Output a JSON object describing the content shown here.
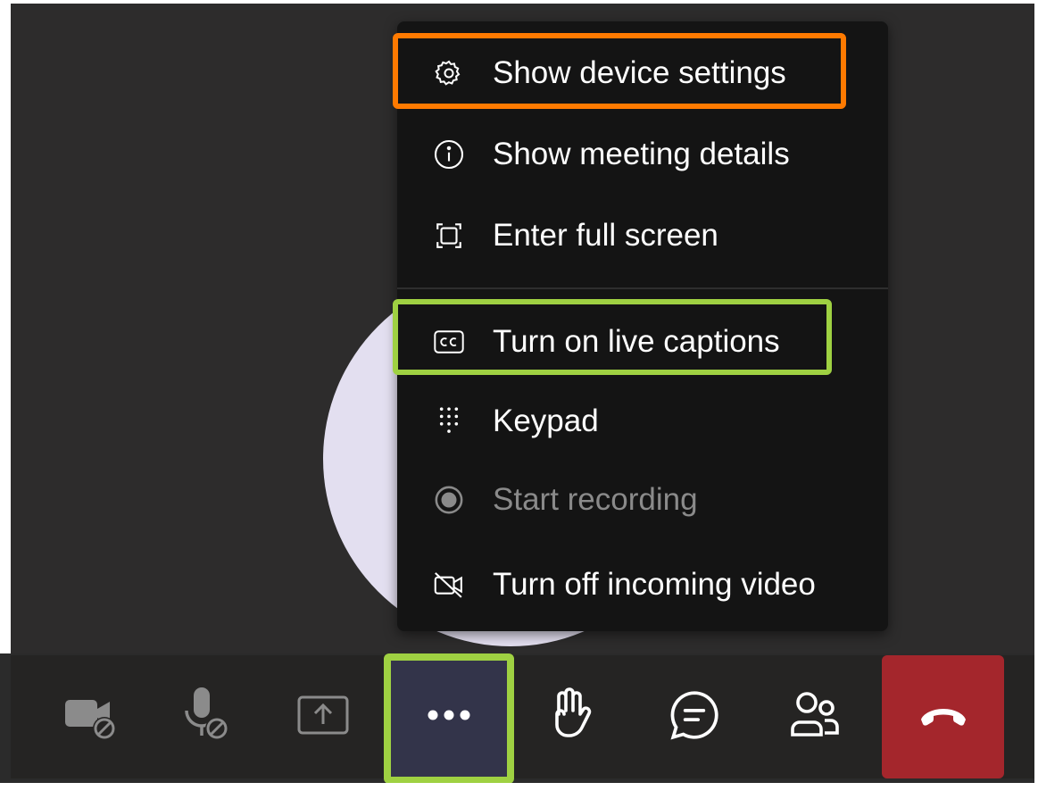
{
  "menu": {
    "items": [
      {
        "label": "Show device settings",
        "icon": "gear-icon"
      },
      {
        "label": "Show meeting details",
        "icon": "info-icon"
      },
      {
        "label": "Enter full screen",
        "icon": "full-screen-icon"
      },
      {
        "label": "Turn on live captions",
        "icon": "closed-captions-icon"
      },
      {
        "label": "Keypad",
        "icon": "keypad-icon"
      },
      {
        "label": "Start recording",
        "icon": "record-icon",
        "disabled": true
      },
      {
        "label": "Turn off incoming video",
        "icon": "video-off-icon"
      }
    ]
  },
  "toolbar": {
    "buttons": [
      {
        "name": "camera-off-button",
        "icon": "camera-off-icon"
      },
      {
        "name": "mic-off-button",
        "icon": "mic-off-icon"
      },
      {
        "name": "share-screen-button",
        "icon": "share-screen-icon"
      },
      {
        "name": "more-actions-button",
        "icon": "ellipsis-icon",
        "active": true
      },
      {
        "name": "raise-hand-button",
        "icon": "hand-icon"
      },
      {
        "name": "chat-button",
        "icon": "chat-icon"
      },
      {
        "name": "participants-button",
        "icon": "participants-icon"
      },
      {
        "name": "leave-button",
        "icon": "hang-up-icon"
      }
    ]
  },
  "colors": {
    "highlight_orange": "#ff7a00",
    "highlight_green": "#9fd142",
    "leave_red": "#a4262c",
    "menu_bg": "#141414",
    "more_active_bg": "#33344a"
  }
}
